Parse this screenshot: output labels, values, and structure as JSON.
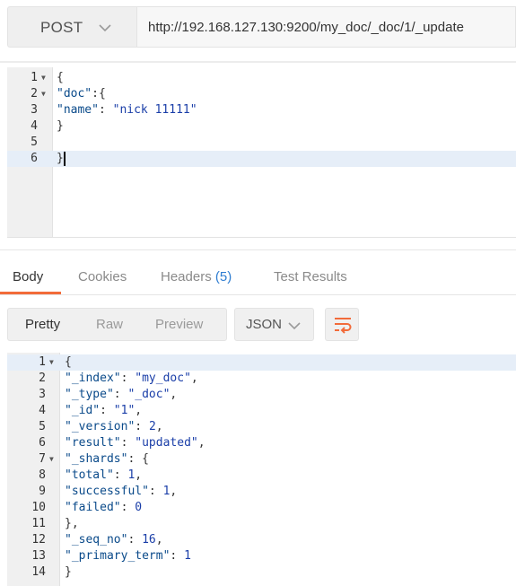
{
  "request": {
    "method": "POST",
    "url": "http://192.168.127.130:9200/my_doc/_doc/1/_update"
  },
  "request_body": [
    {
      "n": "1",
      "fold": true,
      "code": "{"
    },
    {
      "n": "2",
      "fold": true,
      "code": "    \"doc\":{"
    },
    {
      "n": "3",
      "fold": false,
      "code": "        \"name\": \"nick 11111\""
    },
    {
      "n": "4",
      "fold": false,
      "code": "    }"
    },
    {
      "n": "5",
      "fold": false,
      "code": ""
    },
    {
      "n": "6",
      "fold": false,
      "code": "}"
    }
  ],
  "tabs": {
    "body": "Body",
    "cookies": "Cookies",
    "headers": "Headers",
    "headers_count": "(5)",
    "test_results": "Test Results"
  },
  "view": {
    "pretty": "Pretty",
    "raw": "Raw",
    "preview": "Preview",
    "format": "JSON"
  },
  "response_body": [
    {
      "n": "1",
      "fold": true,
      "code": "{"
    },
    {
      "n": "2",
      "fold": false,
      "code": "    \"_index\": \"my_doc\","
    },
    {
      "n": "3",
      "fold": false,
      "code": "    \"_type\": \"_doc\","
    },
    {
      "n": "4",
      "fold": false,
      "code": "    \"_id\": \"1\","
    },
    {
      "n": "5",
      "fold": false,
      "code": "    \"_version\": 2,"
    },
    {
      "n": "6",
      "fold": false,
      "code": "    \"result\": \"updated\","
    },
    {
      "n": "7",
      "fold": true,
      "code": "    \"_shards\": {"
    },
    {
      "n": "8",
      "fold": false,
      "code": "        \"total\": 1,"
    },
    {
      "n": "9",
      "fold": false,
      "code": "        \"successful\": 1,"
    },
    {
      "n": "10",
      "fold": false,
      "code": "        \"failed\": 0"
    },
    {
      "n": "11",
      "fold": false,
      "code": "    },"
    },
    {
      "n": "12",
      "fold": false,
      "code": "    \"_seq_no\": 16,"
    },
    {
      "n": "13",
      "fold": false,
      "code": "    \"_primary_term\": 1"
    },
    {
      "n": "14",
      "fold": false,
      "code": "}"
    }
  ],
  "icons": {
    "method_dropdown": "chevron-down-icon",
    "format_dropdown": "chevron-down-icon",
    "wrap": "wrap-lines-icon"
  },
  "colors": {
    "accent": "#f26b3a",
    "badge": "#2f7dd1"
  }
}
